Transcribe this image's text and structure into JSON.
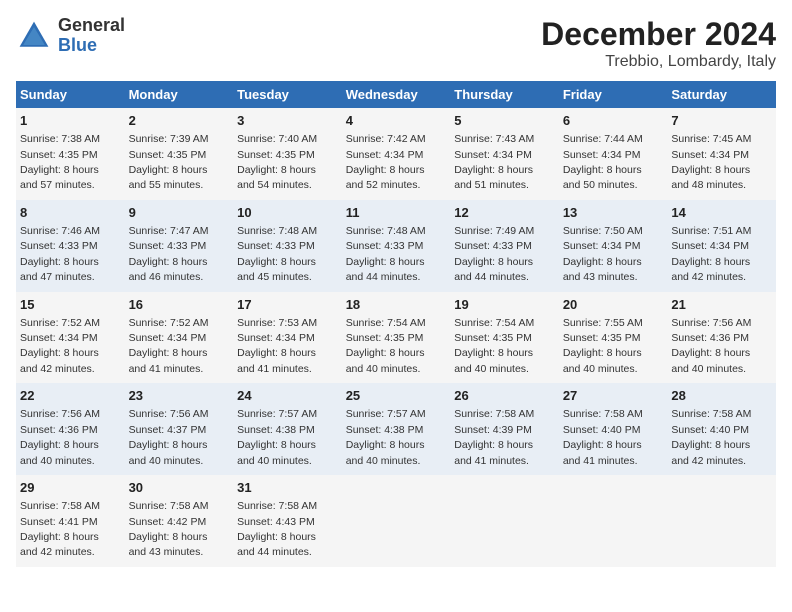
{
  "logo": {
    "general": "General",
    "blue": "Blue"
  },
  "title": "December 2024",
  "subtitle": "Trebbio, Lombardy, Italy",
  "weekdays": [
    "Sunday",
    "Monday",
    "Tuesday",
    "Wednesday",
    "Thursday",
    "Friday",
    "Saturday"
  ],
  "weeks": [
    [
      {
        "day": "1",
        "sunrise": "7:38 AM",
        "sunset": "4:35 PM",
        "daylight": "8 hours and 57 minutes."
      },
      {
        "day": "2",
        "sunrise": "7:39 AM",
        "sunset": "4:35 PM",
        "daylight": "8 hours and 55 minutes."
      },
      {
        "day": "3",
        "sunrise": "7:40 AM",
        "sunset": "4:35 PM",
        "daylight": "8 hours and 54 minutes."
      },
      {
        "day": "4",
        "sunrise": "7:42 AM",
        "sunset": "4:34 PM",
        "daylight": "8 hours and 52 minutes."
      },
      {
        "day": "5",
        "sunrise": "7:43 AM",
        "sunset": "4:34 PM",
        "daylight": "8 hours and 51 minutes."
      },
      {
        "day": "6",
        "sunrise": "7:44 AM",
        "sunset": "4:34 PM",
        "daylight": "8 hours and 50 minutes."
      },
      {
        "day": "7",
        "sunrise": "7:45 AM",
        "sunset": "4:34 PM",
        "daylight": "8 hours and 48 minutes."
      }
    ],
    [
      {
        "day": "8",
        "sunrise": "7:46 AM",
        "sunset": "4:33 PM",
        "daylight": "8 hours and 47 minutes."
      },
      {
        "day": "9",
        "sunrise": "7:47 AM",
        "sunset": "4:33 PM",
        "daylight": "8 hours and 46 minutes."
      },
      {
        "day": "10",
        "sunrise": "7:48 AM",
        "sunset": "4:33 PM",
        "daylight": "8 hours and 45 minutes."
      },
      {
        "day": "11",
        "sunrise": "7:48 AM",
        "sunset": "4:33 PM",
        "daylight": "8 hours and 44 minutes."
      },
      {
        "day": "12",
        "sunrise": "7:49 AM",
        "sunset": "4:33 PM",
        "daylight": "8 hours and 44 minutes."
      },
      {
        "day": "13",
        "sunrise": "7:50 AM",
        "sunset": "4:34 PM",
        "daylight": "8 hours and 43 minutes."
      },
      {
        "day": "14",
        "sunrise": "7:51 AM",
        "sunset": "4:34 PM",
        "daylight": "8 hours and 42 minutes."
      }
    ],
    [
      {
        "day": "15",
        "sunrise": "7:52 AM",
        "sunset": "4:34 PM",
        "daylight": "8 hours and 42 minutes."
      },
      {
        "day": "16",
        "sunrise": "7:52 AM",
        "sunset": "4:34 PM",
        "daylight": "8 hours and 41 minutes."
      },
      {
        "day": "17",
        "sunrise": "7:53 AM",
        "sunset": "4:34 PM",
        "daylight": "8 hours and 41 minutes."
      },
      {
        "day": "18",
        "sunrise": "7:54 AM",
        "sunset": "4:35 PM",
        "daylight": "8 hours and 40 minutes."
      },
      {
        "day": "19",
        "sunrise": "7:54 AM",
        "sunset": "4:35 PM",
        "daylight": "8 hours and 40 minutes."
      },
      {
        "day": "20",
        "sunrise": "7:55 AM",
        "sunset": "4:35 PM",
        "daylight": "8 hours and 40 minutes."
      },
      {
        "day": "21",
        "sunrise": "7:56 AM",
        "sunset": "4:36 PM",
        "daylight": "8 hours and 40 minutes."
      }
    ],
    [
      {
        "day": "22",
        "sunrise": "7:56 AM",
        "sunset": "4:36 PM",
        "daylight": "8 hours and 40 minutes."
      },
      {
        "day": "23",
        "sunrise": "7:56 AM",
        "sunset": "4:37 PM",
        "daylight": "8 hours and 40 minutes."
      },
      {
        "day": "24",
        "sunrise": "7:57 AM",
        "sunset": "4:38 PM",
        "daylight": "8 hours and 40 minutes."
      },
      {
        "day": "25",
        "sunrise": "7:57 AM",
        "sunset": "4:38 PM",
        "daylight": "8 hours and 40 minutes."
      },
      {
        "day": "26",
        "sunrise": "7:58 AM",
        "sunset": "4:39 PM",
        "daylight": "8 hours and 41 minutes."
      },
      {
        "day": "27",
        "sunrise": "7:58 AM",
        "sunset": "4:40 PM",
        "daylight": "8 hours and 41 minutes."
      },
      {
        "day": "28",
        "sunrise": "7:58 AM",
        "sunset": "4:40 PM",
        "daylight": "8 hours and 42 minutes."
      }
    ],
    [
      {
        "day": "29",
        "sunrise": "7:58 AM",
        "sunset": "4:41 PM",
        "daylight": "8 hours and 42 minutes."
      },
      {
        "day": "30",
        "sunrise": "7:58 AM",
        "sunset": "4:42 PM",
        "daylight": "8 hours and 43 minutes."
      },
      {
        "day": "31",
        "sunrise": "7:58 AM",
        "sunset": "4:43 PM",
        "daylight": "8 hours and 44 minutes."
      },
      null,
      null,
      null,
      null
    ]
  ],
  "labels": {
    "sunrise": "Sunrise:",
    "sunset": "Sunset:",
    "daylight": "Daylight:"
  }
}
